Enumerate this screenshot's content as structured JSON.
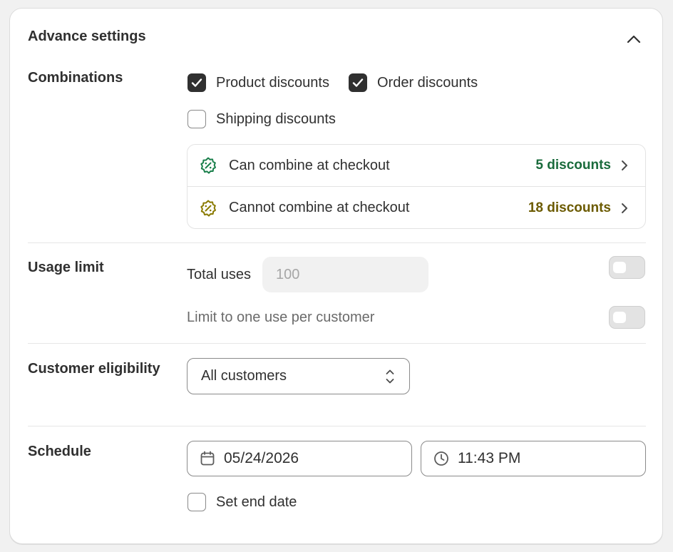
{
  "title": "Advance settings",
  "combinations": {
    "label": "Combinations",
    "product_discounts": {
      "label": "Product discounts",
      "checked": true
    },
    "order_discounts": {
      "label": "Order discounts",
      "checked": true
    },
    "shipping_discounts": {
      "label": "Shipping discounts",
      "checked": false
    },
    "can_combine": {
      "label": "Can combine at checkout",
      "count": "5 discounts",
      "color": "#1a6b3c"
    },
    "cannot_combine": {
      "label": "Cannot combine at checkout",
      "count": "18 discounts",
      "color": "#6b5a00"
    }
  },
  "usage_limit": {
    "label": "Usage limit",
    "total_uses_label": "Total uses",
    "total_uses_placeholder": "100",
    "one_per_customer_label": "Limit to one use per customer"
  },
  "customer_eligibility": {
    "label": "Customer eligibility",
    "selected": "All customers"
  },
  "schedule": {
    "label": "Schedule",
    "date": "05/24/2026",
    "time": "11:43 PM",
    "set_end_date_label": "Set end date",
    "set_end_date_checked": false
  }
}
